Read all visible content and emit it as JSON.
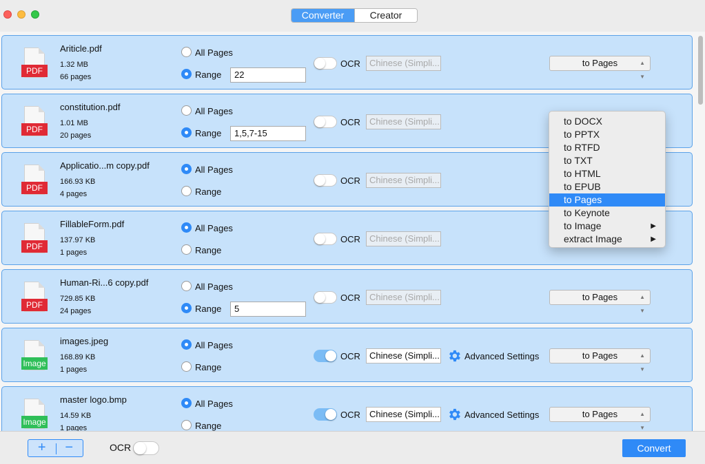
{
  "tabs": [
    {
      "label": "Converter",
      "active": true
    },
    {
      "label": "Creator",
      "active": false
    }
  ],
  "files": [
    {
      "name": "Ariticle.pdf",
      "size": "1.32 MB",
      "pages": "66 pages",
      "type": "PDF",
      "all_pages": false,
      "range": "22",
      "ocr": false,
      "language": "Chinese (Simpli...",
      "advanced": "",
      "format": "to Pages"
    },
    {
      "name": "constitution.pdf",
      "size": "1.01 MB",
      "pages": "20 pages",
      "type": "PDF",
      "all_pages": false,
      "range": "1,5,7-15",
      "ocr": false,
      "language": "Chinese (Simpli...",
      "advanced": "",
      "format": "to Pages"
    },
    {
      "name": "Applicatio...m copy.pdf",
      "size": "166.93 KB",
      "pages": "4 pages",
      "type": "PDF",
      "all_pages": true,
      "range": "",
      "ocr": false,
      "language": "Chinese (Simpli...",
      "advanced": "",
      "format": "to Pages"
    },
    {
      "name": "FillableForm.pdf",
      "size": "137.97 KB",
      "pages": "1 pages",
      "type": "PDF",
      "all_pages": true,
      "range": "",
      "ocr": false,
      "language": "Chinese (Simpli...",
      "advanced": "",
      "format": "to Pages"
    },
    {
      "name": "Human-Ri...6 copy.pdf",
      "size": "729.85 KB",
      "pages": "24 pages",
      "type": "PDF",
      "all_pages": false,
      "range": "5",
      "ocr": false,
      "language": "Chinese (Simpli...",
      "advanced": "",
      "format": "to Pages"
    },
    {
      "name": "images.jpeg",
      "size": "168.89 KB",
      "pages": "1 pages",
      "type": "Image",
      "all_pages": true,
      "range": "",
      "ocr": true,
      "language": "Chinese (Simpli...",
      "advanced": "Advanced Settings",
      "format": "to Pages"
    },
    {
      "name": "master logo.bmp",
      "size": "14.59 KB",
      "pages": "1 pages",
      "type": "Image",
      "all_pages": true,
      "range": "",
      "ocr": true,
      "language": "Chinese (Simpli...",
      "advanced": "Advanced Settings",
      "format": "to Pages"
    }
  ],
  "labels": {
    "all_pages": "All Pages",
    "range": "Range",
    "ocr": "OCR"
  },
  "format_menu": {
    "items": [
      {
        "label": "to DOCX",
        "selected": false,
        "submenu": false
      },
      {
        "label": "to PPTX",
        "selected": false,
        "submenu": false
      },
      {
        "label": "to RTFD",
        "selected": false,
        "submenu": false
      },
      {
        "label": "to TXT",
        "selected": false,
        "submenu": false
      },
      {
        "label": "to HTML",
        "selected": false,
        "submenu": false
      },
      {
        "label": "to EPUB",
        "selected": false,
        "submenu": false
      },
      {
        "label": "to Pages",
        "selected": true,
        "submenu": false
      },
      {
        "label": "to Keynote",
        "selected": false,
        "submenu": false
      },
      {
        "label": "to Image",
        "selected": false,
        "submenu": true
      },
      {
        "label": "extract Image",
        "selected": false,
        "submenu": true
      }
    ]
  },
  "bottom": {
    "add": "+",
    "remove": "−",
    "ocr_label": "OCR",
    "ocr_on": false,
    "convert_label": "Convert"
  },
  "colors": {
    "accent": "#2f8af7",
    "row_bg": "#c7e2fb",
    "row_border": "#5aa1e8",
    "pdf_tag": "#e02a35",
    "image_tag": "#2fbf59"
  }
}
